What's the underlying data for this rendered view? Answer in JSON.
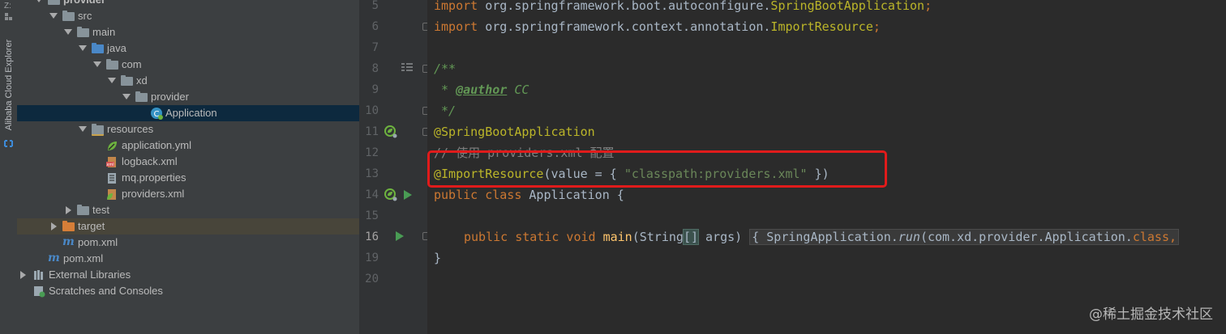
{
  "tool_strip": {
    "top_label": "Z:",
    "vertical_label": "Alibaba Cloud Explorer"
  },
  "tree": {
    "items": [
      {
        "label": "provider",
        "indent": 0
      },
      {
        "label": "src"
      },
      {
        "label": "main"
      },
      {
        "label": "java"
      },
      {
        "label": "com"
      },
      {
        "label": "xd"
      },
      {
        "label": "provider"
      },
      {
        "label": "Application"
      },
      {
        "label": "resources"
      },
      {
        "label": "application.yml"
      },
      {
        "label": "logback.xml"
      },
      {
        "label": "mq.properties"
      },
      {
        "label": "providers.xml"
      },
      {
        "label": "test"
      },
      {
        "label": "target"
      },
      {
        "label": "pom.xml"
      },
      {
        "label": "pom.xml"
      },
      {
        "label": "External Libraries"
      },
      {
        "label": "Scratches and Consoles"
      }
    ]
  },
  "editor": {
    "line_numbers": [
      "5",
      "6",
      "7",
      "8",
      "9",
      "10",
      "11",
      "12",
      "13",
      "14",
      "15",
      "16",
      "19",
      "20"
    ],
    "lines": {
      "l5": {
        "kw": "import",
        "rest": " org.springframework.boot.autoconfigure.",
        "cls": "SpringBootApplication",
        "end": ";"
      },
      "l6": {
        "kw": "import",
        "rest": " org.springframework.context.annotation.",
        "cls": "ImportResource",
        "end": ";"
      },
      "l8": "/**",
      "l9_star": " * ",
      "l9_tag": "@author",
      "l9_text": " CC",
      "l10": " */",
      "l11": "@SpringBootApplication",
      "l12": "// 使用 providers.xml 配置",
      "l13_ann": "@ImportResource",
      "l13_open": "(",
      "l13_param": "value",
      "l13_eq": " = { ",
      "l13_str": "\"classpath:providers.xml\"",
      "l13_close": " })",
      "l14_kw": "public class",
      "l14_rest": " Application {",
      "l16_kw": "public static void",
      "l16_mth": "main",
      "l16_args_a": "(String",
      "l16_args_b": "[]",
      "l16_args_c": " args) ",
      "l16_brace": "{",
      "l16_body_a": " SpringApplication.",
      "l16_body_run": "run",
      "l16_body_b": "(com.xd.provider.Application.",
      "l16_body_kw": "class",
      "l16_body_c": ",",
      "l19": "}"
    }
  },
  "watermark": "@稀土掘金技术社区",
  "colors": {
    "keyword": "#cc7832",
    "annotation": "#bbb529",
    "string": "#6a8759",
    "javadoc": "#629755",
    "comment": "#808080",
    "highlight_box": "#e01b1b",
    "selection": "#0d293e"
  }
}
